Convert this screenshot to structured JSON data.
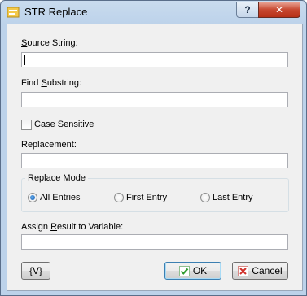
{
  "window": {
    "title": "STR Replace",
    "help_label": "?",
    "close_label": "✕"
  },
  "form": {
    "source_label": "Source String:",
    "source_value": "",
    "find_label": "Find Substring:",
    "find_value": "",
    "case_sensitive_label": "Case Sensitive",
    "case_sensitive_checked": false,
    "replacement_label": "Replacement:",
    "replacement_value": "",
    "replace_mode": {
      "title": "Replace Mode",
      "options": [
        "All Entries",
        "First Entry",
        "Last Entry"
      ],
      "selected": "All Entries"
    },
    "assign_label": "Assign Result to Variable:",
    "assign_value": ""
  },
  "buttons": {
    "variables_label": "{V}",
    "ok_label": "OK",
    "cancel_label": "Cancel"
  },
  "colors": {
    "title_bar": "#bcd2ea",
    "close": "#c7472f",
    "ok_check": "#2e9b2e",
    "cancel_x": "#d0302a"
  }
}
